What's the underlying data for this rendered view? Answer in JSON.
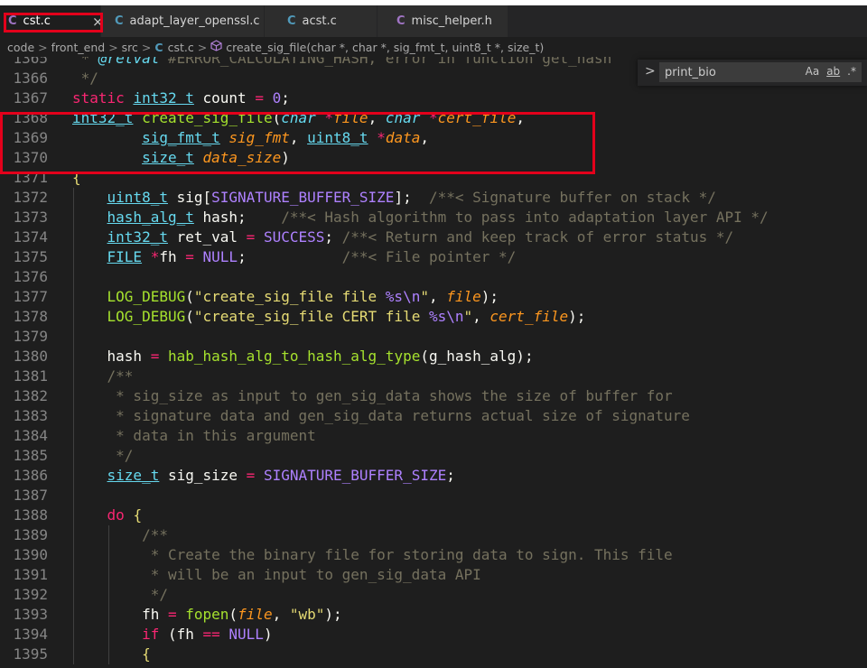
{
  "tabs": [
    {
      "icon": "C",
      "label": "cst.c",
      "active": true,
      "close": "×"
    },
    {
      "icon": "C",
      "label": "adapt_layer_openssl.c",
      "active": false
    },
    {
      "icon": "C",
      "label": "acst.c",
      "active": false
    },
    {
      "icon": "C",
      "label": "misc_helper.h",
      "active": false
    }
  ],
  "breadcrumb": {
    "parts": [
      "code",
      "front_end",
      "src",
      "cst.c",
      "create_sig_file(char *, char *, sig_fmt_t, uint8_t *, size_t)"
    ],
    "separator": ">"
  },
  "find": {
    "value": "print_bio",
    "opt_case": "Aa",
    "opt_word": "ab",
    "opt_regex": ".*",
    "toggle": ">"
  },
  "colors": {
    "highlight_box": "#e3001b",
    "editor_bg": "#1e1e1e"
  },
  "code": {
    "lines": [
      {
        "num": "1365",
        "tokens": [
          [
            "cm",
            " * "
          ],
          [
            "it",
            "@retval"
          ],
          [
            "cm",
            " #ERROR_CALCULATING_HASH, error in function get_hash"
          ]
        ]
      },
      {
        "num": "1366",
        "tokens": [
          [
            "cm",
            " */"
          ]
        ]
      },
      {
        "num": "1367",
        "tokens": [
          [
            "kw",
            "static"
          ],
          [
            "pl",
            " "
          ],
          [
            "ty",
            "int32 t"
          ],
          [
            "pl",
            " count "
          ],
          [
            "kw",
            "="
          ],
          [
            "pl",
            " "
          ],
          [
            "nu",
            "0"
          ],
          [
            "pl",
            ";"
          ]
        ]
      },
      {
        "num": "1368",
        "tokens": [
          [
            "ty",
            "int32_t"
          ],
          [
            "pl",
            " "
          ],
          [
            "fn",
            "create_sig_file"
          ],
          [
            "pl",
            "("
          ],
          [
            "it",
            "char"
          ],
          [
            "pl",
            " "
          ],
          [
            "kw",
            "*"
          ],
          [
            "prm",
            "file"
          ],
          [
            "pl",
            ", "
          ],
          [
            "it",
            "char"
          ],
          [
            "pl",
            " "
          ],
          [
            "kw",
            "*"
          ],
          [
            "prm",
            "cert_file"
          ],
          [
            "pl",
            ","
          ]
        ]
      },
      {
        "num": "1369",
        "tokens": [
          [
            "pl",
            "        "
          ],
          [
            "ty",
            "sig_fmt_t"
          ],
          [
            "pl",
            " "
          ],
          [
            "prm",
            "sig_fmt"
          ],
          [
            "pl",
            ", "
          ],
          [
            "ty",
            "uint8_t"
          ],
          [
            "pl",
            " "
          ],
          [
            "kw",
            "*"
          ],
          [
            "prm",
            "data"
          ],
          [
            "pl",
            ","
          ]
        ]
      },
      {
        "num": "1370",
        "tokens": [
          [
            "pl",
            "        "
          ],
          [
            "ty",
            "size_t"
          ],
          [
            "pl",
            " "
          ],
          [
            "prm",
            "data_size"
          ],
          [
            "pl",
            ")"
          ]
        ]
      },
      {
        "num": "1371",
        "tokens": [
          [
            "st",
            "{"
          ]
        ]
      },
      {
        "num": "1372",
        "tokens": [
          [
            "pl",
            "    "
          ],
          [
            "ty",
            "uint8_t"
          ],
          [
            "pl",
            " sig["
          ],
          [
            "mc",
            "SIGNATURE_BUFFER_SIZE"
          ],
          [
            "pl",
            "];  "
          ],
          [
            "cm",
            "/**< Signature buffer on stack */"
          ]
        ]
      },
      {
        "num": "1373",
        "tokens": [
          [
            "pl",
            "    "
          ],
          [
            "ty",
            "hash_alg_t"
          ],
          [
            "pl",
            " hash;    "
          ],
          [
            "cm",
            "/**< Hash algorithm to pass into adaptation layer API */"
          ]
        ]
      },
      {
        "num": "1374",
        "tokens": [
          [
            "pl",
            "    "
          ],
          [
            "ty",
            "int32_t"
          ],
          [
            "pl",
            " ret_val "
          ],
          [
            "kw",
            "="
          ],
          [
            "pl",
            " "
          ],
          [
            "mc",
            "SUCCESS"
          ],
          [
            "pl",
            "; "
          ],
          [
            "cm",
            "/**< Return and keep track of error status */"
          ]
        ]
      },
      {
        "num": "1375",
        "tokens": [
          [
            "pl",
            "    "
          ],
          [
            "ty",
            "FILE"
          ],
          [
            "pl",
            " "
          ],
          [
            "kw",
            "*"
          ],
          [
            "pl",
            "fh "
          ],
          [
            "kw",
            "="
          ],
          [
            "pl",
            " "
          ],
          [
            "mc",
            "NULL"
          ],
          [
            "pl",
            ";           "
          ],
          [
            "cm",
            "/**< File pointer */"
          ]
        ]
      },
      {
        "num": "1376",
        "tokens": []
      },
      {
        "num": "1377",
        "tokens": [
          [
            "pl",
            "    "
          ],
          [
            "fn",
            "LOG_DEBUG"
          ],
          [
            "pl",
            "("
          ],
          [
            "st",
            "\"create_sig_file file "
          ],
          [
            "mc",
            "%s\\n"
          ],
          [
            "st",
            "\""
          ],
          [
            "pl",
            ", "
          ],
          [
            "prm",
            "file"
          ],
          [
            "pl",
            ");"
          ]
        ]
      },
      {
        "num": "1378",
        "tokens": [
          [
            "pl",
            "    "
          ],
          [
            "fn",
            "LOG_DEBUG"
          ],
          [
            "pl",
            "("
          ],
          [
            "st",
            "\"create_sig_file CERT file "
          ],
          [
            "mc",
            "%s\\n"
          ],
          [
            "st",
            "\""
          ],
          [
            "pl",
            ", "
          ],
          [
            "prm",
            "cert_file"
          ],
          [
            "pl",
            ");"
          ]
        ]
      },
      {
        "num": "1379",
        "tokens": []
      },
      {
        "num": "1380",
        "tokens": [
          [
            "pl",
            "    hash "
          ],
          [
            "kw",
            "="
          ],
          [
            "pl",
            " "
          ],
          [
            "fn",
            "hab_hash_alg_to_hash_alg_type"
          ],
          [
            "pl",
            "(g_hash_alg);"
          ]
        ]
      },
      {
        "num": "1381",
        "tokens": [
          [
            "pl",
            "    "
          ],
          [
            "cm",
            "/**"
          ]
        ]
      },
      {
        "num": "1382",
        "tokens": [
          [
            "pl",
            "    "
          ],
          [
            "cm",
            " * sig_size as input to gen_sig_data shows the size of buffer for"
          ]
        ]
      },
      {
        "num": "1383",
        "tokens": [
          [
            "pl",
            "    "
          ],
          [
            "cm",
            " * signature data and gen_sig_data returns actual size of signature"
          ]
        ]
      },
      {
        "num": "1384",
        "tokens": [
          [
            "pl",
            "    "
          ],
          [
            "cm",
            " * data in this argument"
          ]
        ]
      },
      {
        "num": "1385",
        "tokens": [
          [
            "pl",
            "    "
          ],
          [
            "cm",
            " */"
          ]
        ]
      },
      {
        "num": "1386",
        "tokens": [
          [
            "pl",
            "    "
          ],
          [
            "ty",
            "size_t"
          ],
          [
            "pl",
            " sig_size "
          ],
          [
            "kw",
            "="
          ],
          [
            "pl",
            " "
          ],
          [
            "mc",
            "SIGNATURE_BUFFER_SIZE"
          ],
          [
            "pl",
            ";"
          ]
        ]
      },
      {
        "num": "1387",
        "tokens": []
      },
      {
        "num": "1388",
        "tokens": [
          [
            "pl",
            "    "
          ],
          [
            "kw",
            "do"
          ],
          [
            "pl",
            " "
          ],
          [
            "st",
            "{"
          ]
        ]
      },
      {
        "num": "1389",
        "tokens": [
          [
            "pl",
            "        "
          ],
          [
            "cm",
            "/**"
          ]
        ]
      },
      {
        "num": "1390",
        "tokens": [
          [
            "pl",
            "        "
          ],
          [
            "cm",
            " * Create the binary file for storing data to sign. This file"
          ]
        ]
      },
      {
        "num": "1391",
        "tokens": [
          [
            "pl",
            "        "
          ],
          [
            "cm",
            " * will be an input to gen_sig_data API"
          ]
        ]
      },
      {
        "num": "1392",
        "tokens": [
          [
            "pl",
            "        "
          ],
          [
            "cm",
            " */"
          ]
        ]
      },
      {
        "num": "1393",
        "tokens": [
          [
            "pl",
            "        fh "
          ],
          [
            "kw",
            "="
          ],
          [
            "pl",
            " "
          ],
          [
            "fn",
            "fopen"
          ],
          [
            "pl",
            "("
          ],
          [
            "prm",
            "file"
          ],
          [
            "pl",
            ", "
          ],
          [
            "st",
            "\"wb\""
          ],
          [
            "pl",
            ");"
          ]
        ]
      },
      {
        "num": "1394",
        "tokens": [
          [
            "pl",
            "        "
          ],
          [
            "kw",
            "if"
          ],
          [
            "pl",
            " (fh "
          ],
          [
            "kw",
            "=="
          ],
          [
            "pl",
            " "
          ],
          [
            "mc",
            "NULL"
          ],
          [
            "pl",
            ")"
          ]
        ]
      },
      {
        "num": "1395",
        "tokens": [
          [
            "pl",
            "        "
          ],
          [
            "st",
            "{"
          ]
        ]
      }
    ]
  }
}
